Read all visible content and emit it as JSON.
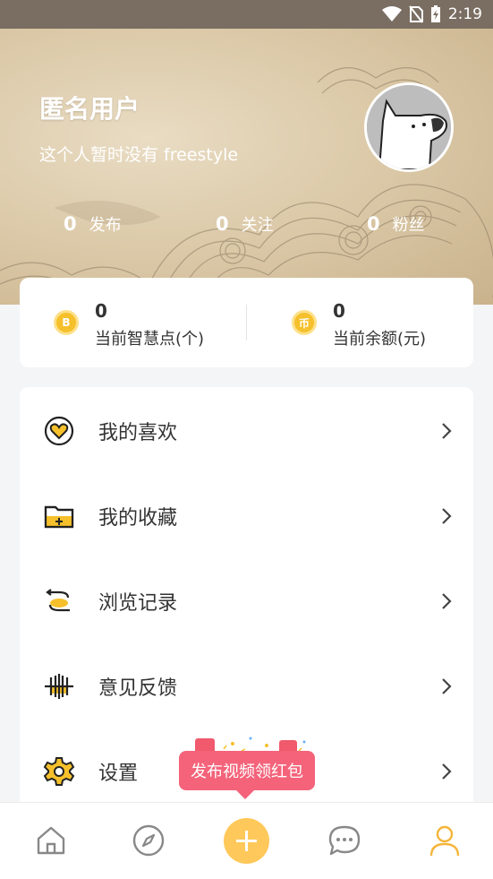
{
  "status_bar": {
    "time": "2:19",
    "icons": [
      "wifi-icon",
      "no-sim-icon",
      "battery-charging-icon"
    ]
  },
  "profile": {
    "username": "匿名用户",
    "bio": "这个人暂时没有 freestyle",
    "avatar": "dog-avatar",
    "stats": [
      {
        "num": "0",
        "label": "发布"
      },
      {
        "num": "0",
        "label": "关注"
      },
      {
        "num": "0",
        "label": "粉丝"
      }
    ]
  },
  "balance": [
    {
      "value": "0",
      "label": "当前智慧点(个)",
      "icon": "B",
      "icon_name": "wisdom-coin-icon"
    },
    {
      "value": "0",
      "label": "当前余额(元)",
      "icon": "币",
      "icon_name": "balance-coin-icon"
    }
  ],
  "menu": [
    {
      "label": "我的喜欢",
      "icon": "heart-icon"
    },
    {
      "label": "我的收藏",
      "icon": "folder-icon"
    },
    {
      "label": "浏览记录",
      "icon": "history-icon"
    },
    {
      "label": "意见反馈",
      "icon": "feedback-icon"
    },
    {
      "label": "设置",
      "icon": "settings-gear-icon"
    }
  ],
  "promo": {
    "text": "发布视频领红包"
  },
  "bottom_nav": [
    "home-icon",
    "discover-compass-icon",
    "publish-plus-icon",
    "messages-icon",
    "profile-icon"
  ],
  "colors": {
    "accent": "#ffc85a",
    "promo": "#f4637a",
    "active_nav": "#f5b53a",
    "icon_yellow": "#f5c02b"
  }
}
